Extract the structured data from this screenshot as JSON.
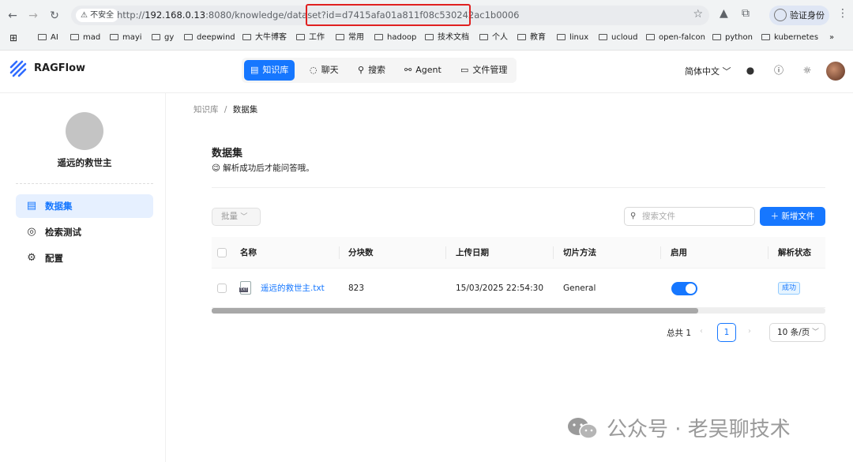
{
  "browser": {
    "security_label": "不安全",
    "url_prefix": "http://",
    "url_host": "192.168.0.13",
    "url_rest": ":8080/knowledge/dataset?id=d7415afa01a811f08c530242ac1b0006",
    "verify_label": "验证身份",
    "bookmarks": [
      "AI",
      "mad",
      "mayi",
      "gy",
      "deepwind",
      "大牛博客",
      "工作",
      "常用",
      "hadoop",
      "技术文档",
      "个人",
      "教育",
      "linux",
      "ucloud",
      "open-falcon",
      "python",
      "kubernetes"
    ]
  },
  "app": {
    "logo_text": "RAGFlow",
    "nav": [
      {
        "label": "知识库",
        "icon": "database-icon"
      },
      {
        "label": "聊天",
        "icon": "chat-icon"
      },
      {
        "label": "搜索",
        "icon": "search-icon"
      },
      {
        "label": "Agent",
        "icon": "agent-icon"
      },
      {
        "label": "文件管理",
        "icon": "folder-icon"
      }
    ],
    "language": "简体中文"
  },
  "sidebar": {
    "username": "遥远的救世主",
    "items": [
      {
        "label": "数据集",
        "icon": "document-icon"
      },
      {
        "label": "检索测试",
        "icon": "target-icon"
      },
      {
        "label": "配置",
        "icon": "gear-icon"
      }
    ]
  },
  "main": {
    "breadcrumb_root": "知识库",
    "breadcrumb_sep": "/",
    "breadcrumb_current": "数据集",
    "title": "数据集",
    "subtitle": "😉 解析成功后才能问答哦。",
    "batch_label": "批量",
    "search_placeholder": "搜索文件",
    "add_label": "新增文件",
    "columns": [
      "名称",
      "分块数",
      "上传日期",
      "切片方法",
      "启用",
      "解析状态"
    ],
    "rows": [
      {
        "name": "遥远的救世主.txt",
        "file_type": "TXT",
        "chunks": "823",
        "upload_date": "15/03/2025 22:54:30",
        "method": "General",
        "enabled": true,
        "status": "成功"
      }
    ],
    "pagination": {
      "total": "总共 1",
      "current": "1",
      "page_size": "10 条/页"
    }
  },
  "watermark": "公众号 · 老吴聊技术"
}
